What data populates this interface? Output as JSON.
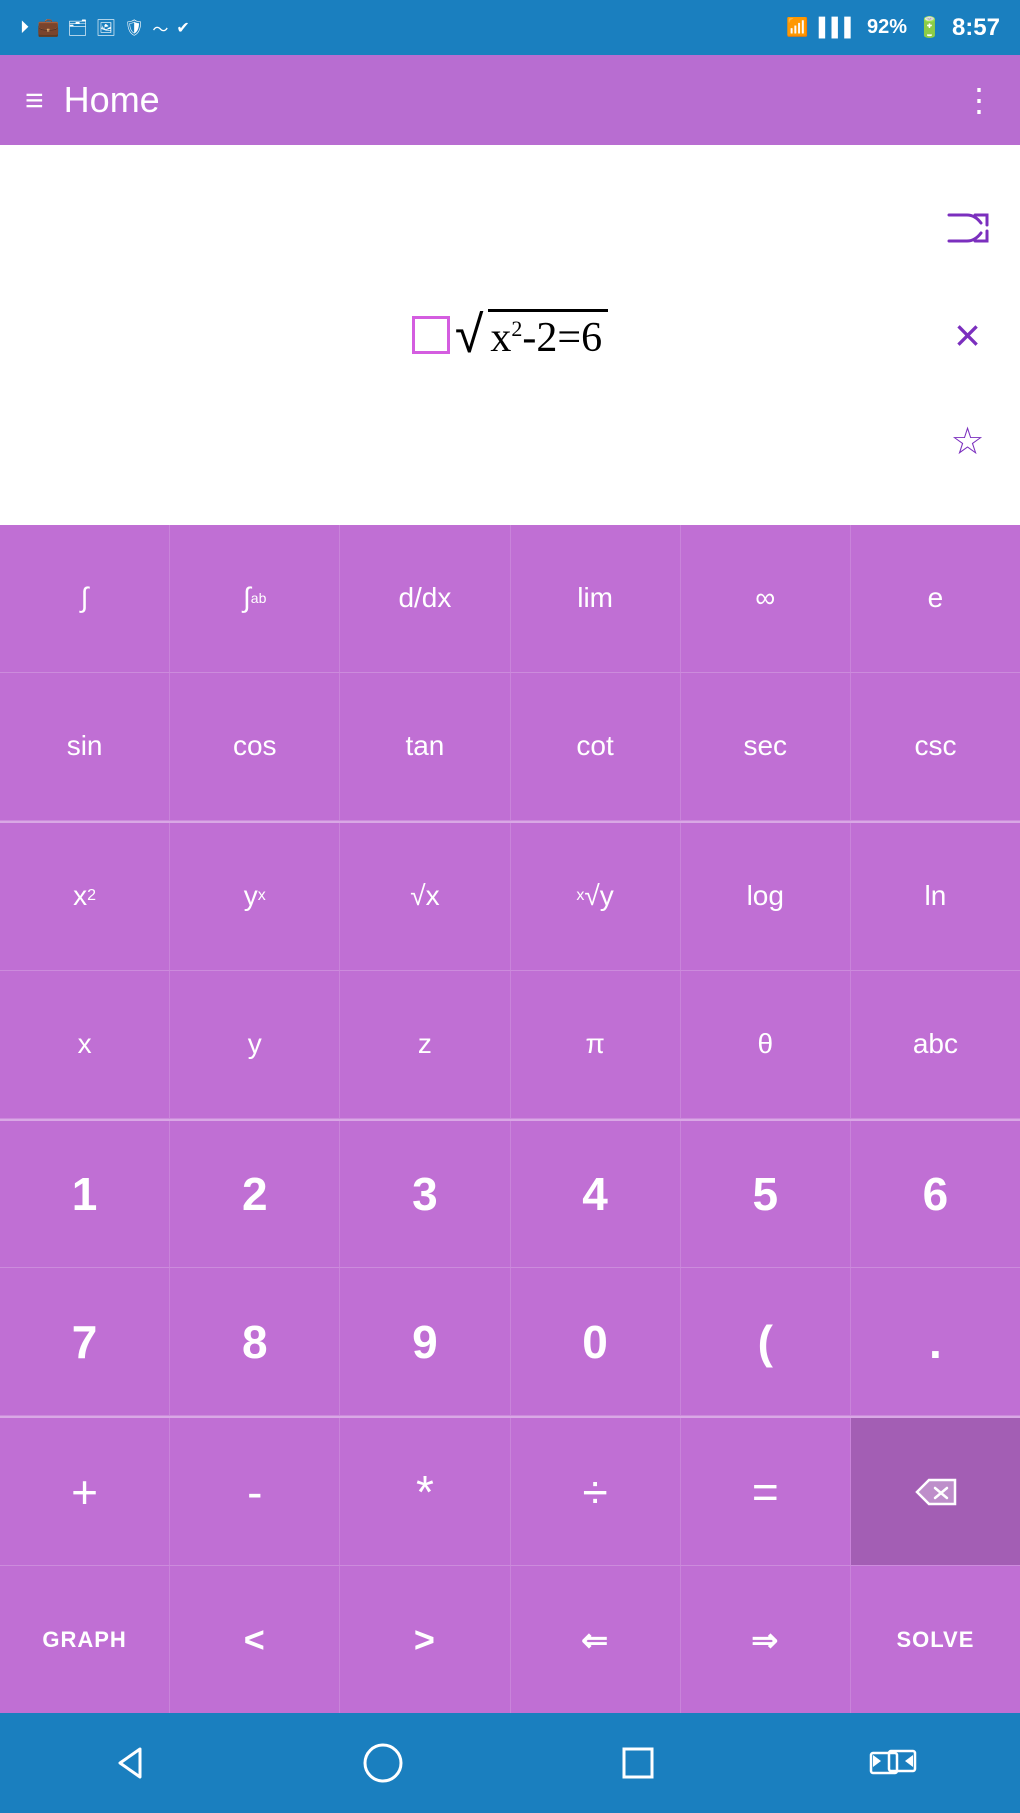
{
  "statusBar": {
    "battery": "92%",
    "time": "8:57",
    "icons": [
      "play",
      "briefcase",
      "briefcase2",
      "image",
      "shield",
      "wifi-signal",
      "check"
    ]
  },
  "appBar": {
    "title": "Home",
    "menuIcon": "≡",
    "moreIcon": "⋮"
  },
  "expression": {
    "display": "□√x²-2=6"
  },
  "actions": {
    "shuffle": "shuffle",
    "close": "×",
    "star": "☆"
  },
  "keyboard": {
    "row1": [
      {
        "label": "∫",
        "id": "integral"
      },
      {
        "label": "∫ᵃᵇ",
        "id": "definite-integral"
      },
      {
        "label": "d/dx",
        "id": "derivative"
      },
      {
        "label": "lim",
        "id": "limit"
      },
      {
        "label": "∞",
        "id": "infinity"
      },
      {
        "label": "e",
        "id": "euler"
      }
    ],
    "row2": [
      {
        "label": "sin",
        "id": "sin"
      },
      {
        "label": "cos",
        "id": "cos"
      },
      {
        "label": "tan",
        "id": "tan"
      },
      {
        "label": "cot",
        "id": "cot"
      },
      {
        "label": "sec",
        "id": "sec"
      },
      {
        "label": "csc",
        "id": "csc"
      }
    ],
    "row3": [
      {
        "label": "x²",
        "id": "x-squared"
      },
      {
        "label": "yˣ",
        "id": "y-to-x"
      },
      {
        "label": "√x",
        "id": "sqrt"
      },
      {
        "label": "ˣ√y",
        "id": "nth-root"
      },
      {
        "label": "log",
        "id": "log"
      },
      {
        "label": "ln",
        "id": "ln"
      }
    ],
    "row4": [
      {
        "label": "x",
        "id": "x"
      },
      {
        "label": "y",
        "id": "y"
      },
      {
        "label": "z",
        "id": "z"
      },
      {
        "label": "π",
        "id": "pi"
      },
      {
        "label": "θ",
        "id": "theta"
      },
      {
        "label": "abc",
        "id": "abc"
      }
    ],
    "row5": [
      {
        "label": "1",
        "id": "1"
      },
      {
        "label": "2",
        "id": "2"
      },
      {
        "label": "3",
        "id": "3"
      },
      {
        "label": "4",
        "id": "4"
      },
      {
        "label": "5",
        "id": "5"
      },
      {
        "label": "6",
        "id": "6"
      }
    ],
    "row6": [
      {
        "label": "7",
        "id": "7"
      },
      {
        "label": "8",
        "id": "8"
      },
      {
        "label": "9",
        "id": "9"
      },
      {
        "label": "0",
        "id": "0"
      },
      {
        "label": "(",
        "id": "left-paren"
      },
      {
        "label": ".",
        "id": "decimal"
      }
    ],
    "row7": [
      {
        "label": "+",
        "id": "plus"
      },
      {
        "label": "-",
        "id": "minus"
      },
      {
        "label": "*",
        "id": "multiply"
      },
      {
        "label": "÷",
        "id": "divide"
      },
      {
        "label": "=",
        "id": "equals"
      },
      {
        "label": "⌫",
        "id": "backspace"
      }
    ],
    "row8": [
      {
        "label": "GRAPH",
        "id": "graph"
      },
      {
        "label": "<",
        "id": "less-than"
      },
      {
        "label": ">",
        "id": "greater-than"
      },
      {
        "label": "⇐",
        "id": "cursor-left"
      },
      {
        "label": "⇒",
        "id": "cursor-right"
      },
      {
        "label": "SOLVE",
        "id": "solve"
      }
    ]
  },
  "navBar": {
    "back": "◁",
    "home": "○",
    "recent": "□",
    "switch": "⇄"
  }
}
